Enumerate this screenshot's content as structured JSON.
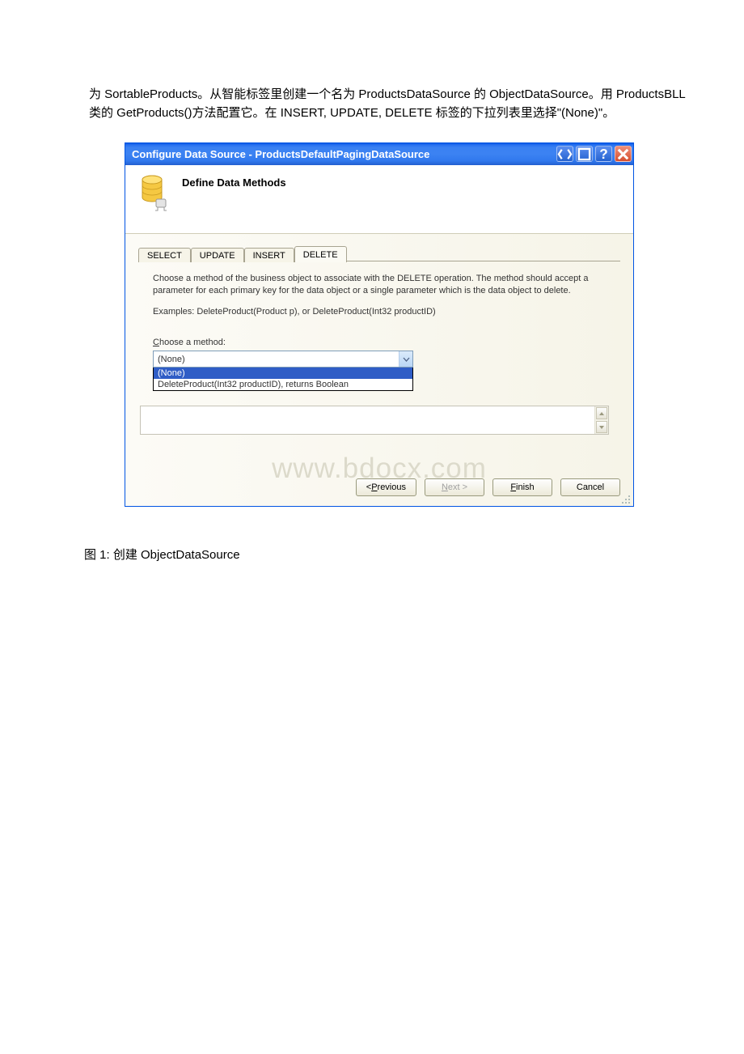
{
  "intro": "为 SortableProducts。从智能标签里创建一个名为 ProductsDataSource 的 ObjectDataSource。用 ProductsBLL 类的 GetProducts()方法配置它。在 INSERT, UPDATE, DELETE 标签的下拉列表里选择\"(None)\"。",
  "dialog": {
    "title": "Configure Data Source - ProductsDefaultPagingDataSource",
    "headerTitle": "Define Data Methods",
    "tabs": {
      "select": "SELECT",
      "update": "UPDATE",
      "insert": "INSERT",
      "delete": "DELETE"
    },
    "description": "Choose a method of the business object to associate with the DELETE operation. The method should accept a parameter for each primary key for the data object or a single parameter which is the data object to delete.",
    "examples": "Examples: DeleteProduct(Product p), or DeleteProduct(Int32 productID)",
    "chooseLabel": "Choose a method:",
    "dropdownSelected": "(None)",
    "dropdownOptions": {
      "none": "(None)",
      "deleteProduct": "DeleteProduct(Int32 productID), returns Boolean"
    },
    "buttons": {
      "previous": "< Previous",
      "next": "Next >",
      "finish": "Finish",
      "cancel": "Cancel"
    }
  },
  "watermark": "www.bdocx.com",
  "caption": "图 1: 创建 ObjectDataSource"
}
